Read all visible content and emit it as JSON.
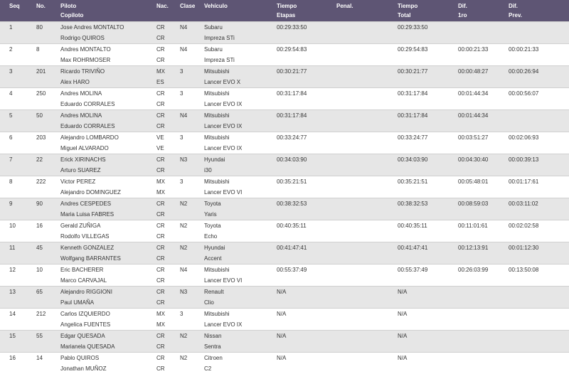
{
  "header": {
    "seq": "Seq",
    "no": "No.",
    "piloto": "Piloto",
    "copiloto": "Copiloto",
    "nac": "Nac.",
    "clase": "Clase",
    "vehiculo": "Vehículo",
    "tiempo_etapas_1": "Tiempo",
    "tiempo_etapas_2": "Etapas",
    "penal": "Penal.",
    "tiempo_total_1": "Tiempo",
    "tiempo_total_2": "Total",
    "dif1ro_1": "Dif.",
    "dif1ro_2": "1ro",
    "difprev_1": "Dif.",
    "difprev_2": "Prev."
  },
  "rows": [
    {
      "seq": "1",
      "no": "80",
      "piloto": "Jose Andres MONTALTO",
      "copiloto": "Rodrigo QUIROS",
      "nac1": "CR",
      "nac2": "CR",
      "clase": "N4",
      "marca": "Subaru",
      "modelo": "Impreza STi",
      "etapas": "00:29:33:50",
      "penal": "",
      "total": "00:29:33:50",
      "dif1": "",
      "difp": ""
    },
    {
      "seq": "2",
      "no": "8",
      "piloto": "Andres MONTALTO",
      "copiloto": "Max ROHRMOSER",
      "nac1": "CR",
      "nac2": "CR",
      "clase": "N4",
      "marca": "Subaru",
      "modelo": "Impreza STi",
      "etapas": "00:29:54:83",
      "penal": "",
      "total": "00:29:54:83",
      "dif1": "00:00:21:33",
      "difp": "00:00:21:33"
    },
    {
      "seq": "3",
      "no": "201",
      "piloto": "Ricardo TRIVIÑO",
      "copiloto": "Alex HARO",
      "nac1": "MX",
      "nac2": "ES",
      "clase": "3",
      "marca": "Mitsubishi",
      "modelo": "Lancer EVO X",
      "etapas": "00:30:21:77",
      "penal": "",
      "total": "00:30:21:77",
      "dif1": "00:00:48:27",
      "difp": "00:00:26:94"
    },
    {
      "seq": "4",
      "no": "250",
      "piloto": "Andres MOLINA",
      "copiloto": "Eduardo CORRALES",
      "nac1": "CR",
      "nac2": "CR",
      "clase": "3",
      "marca": "Mitsubishi",
      "modelo": "Lancer EVO IX",
      "etapas": "00:31:17:84",
      "penal": "",
      "total": "00:31:17:84",
      "dif1": "00:01:44:34",
      "difp": "00:00:56:07"
    },
    {
      "seq": "5",
      "no": "50",
      "piloto": "Andres MOLINA",
      "copiloto": "Eduardo CORRALES",
      "nac1": "CR",
      "nac2": "CR",
      "clase": "N4",
      "marca": "Mitsubishi",
      "modelo": "Lancer EVO IX",
      "etapas": "00:31:17:84",
      "penal": "",
      "total": "00:31:17:84",
      "dif1": "00:01:44:34",
      "difp": ""
    },
    {
      "seq": "6",
      "no": "203",
      "piloto": "Alejandro LOMBARDO",
      "copiloto": "Miguel ALVARADO",
      "nac1": "VE",
      "nac2": "VE",
      "clase": "3",
      "marca": "Mitsubishi",
      "modelo": "Lancer EVO IX",
      "etapas": "00:33:24:77",
      "penal": "",
      "total": "00:33:24:77",
      "dif1": "00:03:51:27",
      "difp": "00:02:06:93"
    },
    {
      "seq": "7",
      "no": "22",
      "piloto": "Erick XIRINACHS",
      "copiloto": "Arturo SUAREZ",
      "nac1": "CR",
      "nac2": "CR",
      "clase": "N3",
      "marca": "Hyundai",
      "modelo": "i30",
      "etapas": "00:34:03:90",
      "penal": "",
      "total": "00:34:03:90",
      "dif1": "00:04:30:40",
      "difp": "00:00:39:13"
    },
    {
      "seq": "8",
      "no": "222",
      "piloto": "Victor PEREZ",
      "copiloto": "Alejandro DOMINGUEZ",
      "nac1": "MX",
      "nac2": "MX",
      "clase": "3",
      "marca": "Mitsubishi",
      "modelo": "Lancer EVO VI",
      "etapas": "00:35:21:51",
      "penal": "",
      "total": "00:35:21:51",
      "dif1": "00:05:48:01",
      "difp": "00:01:17:61"
    },
    {
      "seq": "9",
      "no": "90",
      "piloto": "Andres CESPEDES",
      "copiloto": "Maria Luisa FABRES",
      "nac1": "CR",
      "nac2": "CR",
      "clase": "N2",
      "marca": "Toyota",
      "modelo": "Yaris",
      "etapas": "00:38:32:53",
      "penal": "",
      "total": "00:38:32:53",
      "dif1": "00:08:59:03",
      "difp": "00:03:11:02"
    },
    {
      "seq": "10",
      "no": "16",
      "piloto": "Gerald ZUÑIGA",
      "copiloto": "Rodolfo VILLEGAS",
      "nac1": "CR",
      "nac2": "CR",
      "clase": "N2",
      "marca": "Toyota",
      "modelo": "Echo",
      "etapas": "00:40:35:11",
      "penal": "",
      "total": "00:40:35:11",
      "dif1": "00:11:01:61",
      "difp": "00:02:02:58"
    },
    {
      "seq": "11",
      "no": "45",
      "piloto": "Kenneth GONZALEZ",
      "copiloto": "Wolfgang BARRANTES",
      "nac1": "CR",
      "nac2": "CR",
      "clase": "N2",
      "marca": "Hyundai",
      "modelo": "Accent",
      "etapas": "00:41:47:41",
      "penal": "",
      "total": "00:41:47:41",
      "dif1": "00:12:13:91",
      "difp": "00:01:12:30"
    },
    {
      "seq": "12",
      "no": "10",
      "piloto": "Eric BACHERER",
      "copiloto": "Marco CARVAJAL",
      "nac1": "CR",
      "nac2": "CR",
      "clase": "N4",
      "marca": "Mitsubishi",
      "modelo": "Lancer EVO VI",
      "etapas": "00:55:37:49",
      "penal": "",
      "total": "00:55:37:49",
      "dif1": "00:26:03:99",
      "difp": "00:13:50:08"
    },
    {
      "seq": "13",
      "no": "65",
      "piloto": "Alejandro RIGGIONI",
      "copiloto": "Paul UMAÑA",
      "nac1": "CR",
      "nac2": "CR",
      "clase": "N3",
      "marca": "Renault",
      "modelo": "Clio",
      "etapas": "N/A",
      "penal": "",
      "total": "N/A",
      "dif1": "",
      "difp": ""
    },
    {
      "seq": "14",
      "no": "212",
      "piloto": "Carlos IZQUIERDO",
      "copiloto": "Angelica FUENTES",
      "nac1": "MX",
      "nac2": "MX",
      "clase": "3",
      "marca": "Mitsubishi",
      "modelo": "Lancer EVO IX",
      "etapas": "N/A",
      "penal": "",
      "total": "N/A",
      "dif1": "",
      "difp": ""
    },
    {
      "seq": "15",
      "no": "55",
      "piloto": "Edgar QUESADA",
      "copiloto": "Marianela QUESADA",
      "nac1": "CR",
      "nac2": "CR",
      "clase": "N2",
      "marca": "Nissan",
      "modelo": "Sentra",
      "etapas": "N/A",
      "penal": "",
      "total": "N/A",
      "dif1": "",
      "difp": ""
    },
    {
      "seq": "16",
      "no": "14",
      "piloto": "Pablo QUIROS",
      "copiloto": "Jonathan MUÑOZ",
      "nac1": "CR",
      "nac2": "CR",
      "clase": "N2",
      "marca": "Citroen",
      "modelo": "C2",
      "etapas": "N/A",
      "penal": "",
      "total": "N/A",
      "dif1": "",
      "difp": ""
    }
  ]
}
